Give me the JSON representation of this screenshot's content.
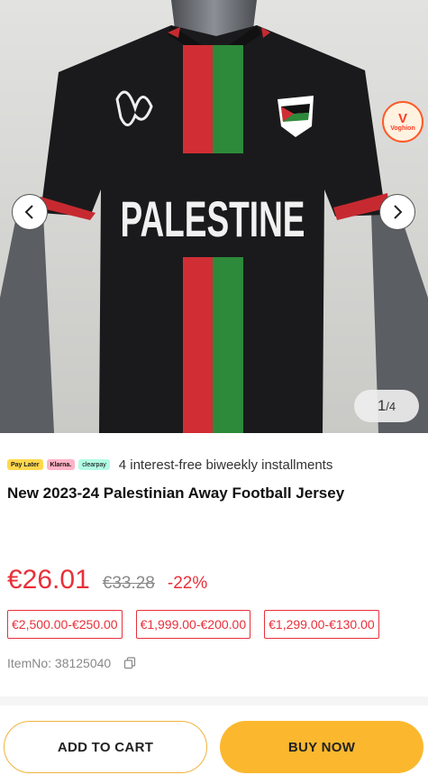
{
  "gallery": {
    "jersey_text": "PALESTINE",
    "counter_current": "1",
    "counter_separator": "/",
    "counter_total": "4",
    "promo_badge_text": "Voghion"
  },
  "payment": {
    "pills": [
      "Pay Later",
      "Klarna.",
      "clearpay"
    ],
    "installments_text": "4 interest-free biweekly installments"
  },
  "product": {
    "title": "New 2023-24 Palestinian Away Football Jersey",
    "price_current": "€26.01",
    "price_original": "€33.28",
    "discount": "-22%",
    "price_tiers": [
      "€2,500.00-€250.00",
      "€1,999.00-€200.00",
      "€1,299.00-€130.00"
    ],
    "item_no": "ItemNo: 38125040"
  },
  "actions": {
    "add_to_cart": "ADD TO CART",
    "buy_now": "BUY NOW"
  },
  "colors": {
    "price_red": "#e8303a",
    "button_yellow": "#fbb82e"
  }
}
